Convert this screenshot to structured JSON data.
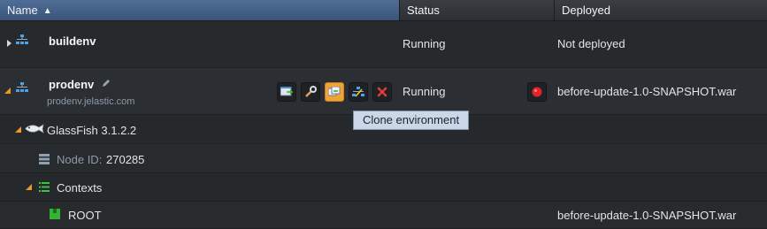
{
  "columns": {
    "name": "Name",
    "status": "Status",
    "deployed": "Deployed"
  },
  "environments": [
    {
      "name": "buildenv",
      "status": "Running",
      "deployed": "Not deployed"
    },
    {
      "name": "prodenv",
      "domain": "prodenv.jelastic.com",
      "status": "Running",
      "deployed": "before-update-1.0-SNAPSHOT.war"
    }
  ],
  "tooltip": "Clone environment",
  "tree": {
    "server": "GlassFish 3.1.2.2",
    "node_label": "Node ID:",
    "node_id": "270285",
    "contexts": "Contexts",
    "context_name": "ROOT",
    "context_deployed": "before-update-1.0-SNAPSHOT.war"
  },
  "colors": {
    "accent": "#f1a236",
    "header_selected": "#3b5579",
    "expander": "#e89a2a"
  }
}
